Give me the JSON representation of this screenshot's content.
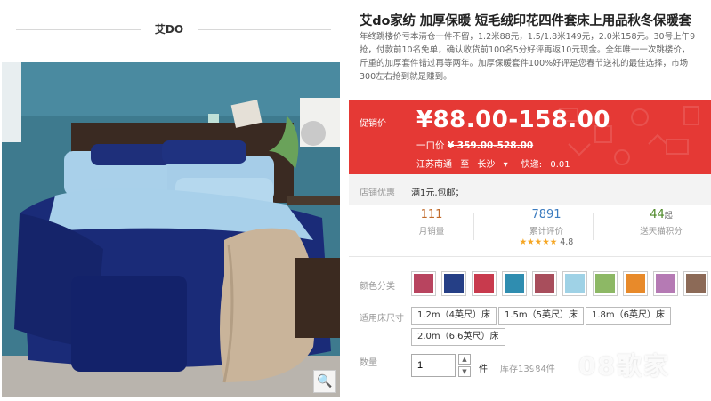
{
  "shop": {
    "name": "艾DO"
  },
  "product": {
    "title": "艾do家纺 加厚保暖 短毛绒印花四件套床上用品秋冬保暖套",
    "desc_lines": [
      "年终跳楼价亏本清仓一件不留，1.2米88元，1.5/1.8米149元，2.0米158元。30号上午9",
      "抢，付款前10名免单，确认收货前100名5分好评再返10元现金。全年唯一一次跳楼价，",
      "斤重的加厚套件错过再等两年。加厚保暖套件100%好评是您春节送礼的最佳选择，市场",
      "300左右抢到就是赚到。"
    ]
  },
  "price": {
    "promo_label": "促销价",
    "promo_value": "¥88.00-158.00",
    "orig_label": "一口价",
    "orig_value": "¥ 359.00-528.00",
    "ship_from": "江苏南通",
    "ship_to_label": "至",
    "ship_to": "长沙",
    "ship_fee_label": "快递:",
    "ship_fee": "0.01"
  },
  "shop_promo": {
    "label": "店铺优惠",
    "value": "满1元,包邮；"
  },
  "stats": {
    "sales": {
      "value": "111",
      "label": "月销量"
    },
    "reviews": {
      "value": "7891",
      "label": "累计评价",
      "stars": "★★★★★",
      "score": "4.8"
    },
    "points": {
      "value": "44",
      "suffix": "起",
      "label": "送天猫积分"
    }
  },
  "color_label": "颜色分类",
  "colors": [
    {
      "name": "color-1",
      "color": "#b8445f"
    },
    {
      "name": "color-2",
      "color": "#253f86"
    },
    {
      "name": "color-3",
      "color": "#c83a4d"
    },
    {
      "name": "color-4",
      "color": "#2f8db0"
    },
    {
      "name": "color-5",
      "color": "#a84e5c"
    },
    {
      "name": "color-6",
      "color": "#9fd2e6"
    },
    {
      "name": "color-7",
      "color": "#8db865"
    },
    {
      "name": "color-8",
      "color": "#e88a2a"
    },
    {
      "name": "color-9",
      "color": "#b57ab4"
    },
    {
      "name": "color-10",
      "color": "#8c6a57"
    }
  ],
  "size_label": "适用床尺寸",
  "sizes": [
    "1.2m（4英尺）床",
    "1.5m（5英尺）床",
    "1.8m（6英尺）床",
    "2.0m（6.6英尺）床"
  ],
  "qty": {
    "label": "数量",
    "value": "1",
    "unit": "件",
    "stock": "库存13984件"
  },
  "watermark": "08歌家",
  "theme": {
    "accent": "#e53935",
    "star": "#f5a623"
  }
}
